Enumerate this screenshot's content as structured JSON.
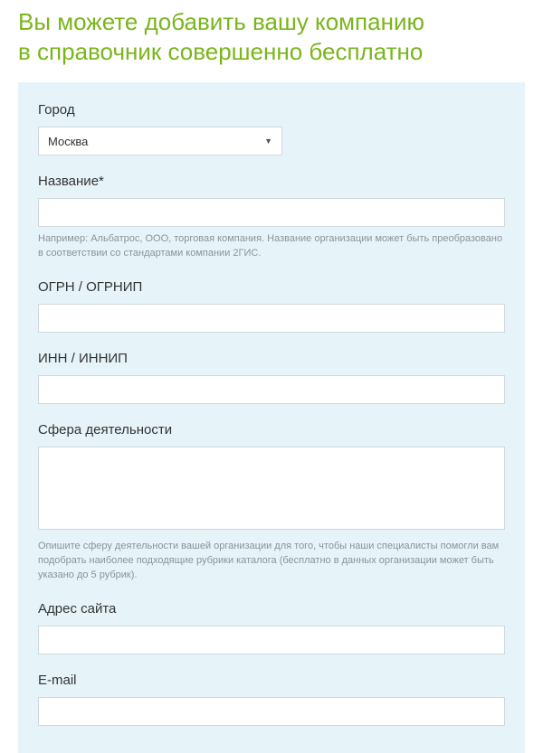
{
  "page": {
    "title_line1": "Вы можете добавить вашу компанию",
    "title_line2": "в справочник совершенно бесплатно"
  },
  "form": {
    "city": {
      "label": "Город",
      "selected": "Москва"
    },
    "name": {
      "label": "Название*",
      "value": "",
      "hint": "Например: Альбатрос, ООО, торговая компания. Название организации может быть преобразовано в соответствии со стандартами компании 2ГИС."
    },
    "ogrn": {
      "label": "ОГРН / ОГРНИП",
      "value": ""
    },
    "inn": {
      "label": "ИНН / ИННИП",
      "value": ""
    },
    "activity": {
      "label": "Сфера деятельности",
      "value": "",
      "hint": "Опишите сферу деятельности вашей организации для того, чтобы наши специалисты помогли вам подобрать наиболее подходящие рубрики каталога (бесплатно в данных организации может быть указано до 5 рубрик)."
    },
    "site": {
      "label": "Адрес сайта",
      "value": ""
    },
    "email": {
      "label": "E-mail",
      "value": ""
    }
  }
}
